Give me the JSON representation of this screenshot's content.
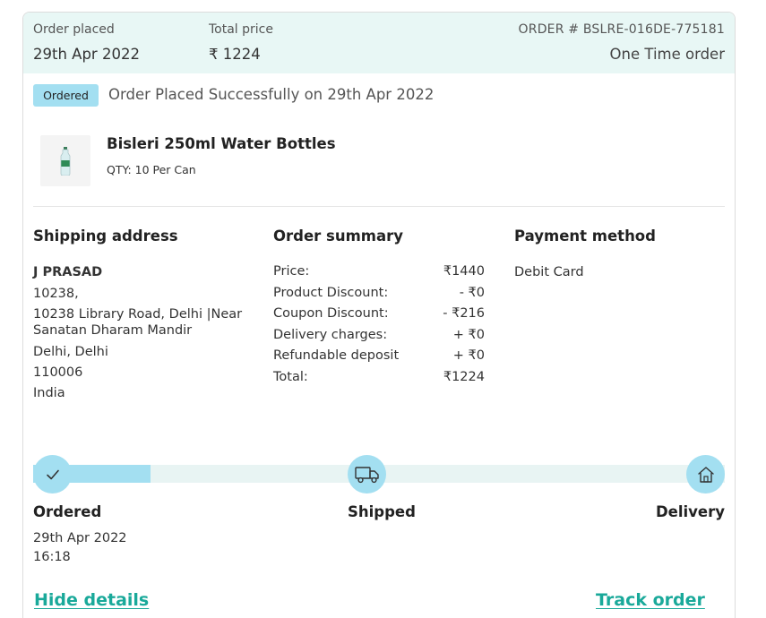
{
  "header": {
    "placed_label": "Order placed",
    "placed_date": "29th Apr 2022",
    "total_label": "Total price",
    "total_value": "₹ 1224",
    "order_number": "ORDER # BSLRE-016DE-775181",
    "order_type": "One Time order"
  },
  "status": {
    "badge": "Ordered",
    "message": "Order Placed Successfully on 29th Apr 2022"
  },
  "product": {
    "icon": "water-bottle-icon",
    "name": "Bisleri 250ml Water Bottles",
    "qty": "QTY: 10 Per Can"
  },
  "shipping": {
    "title": "Shipping address",
    "name": "J PRASAD",
    "line1": "10238,",
    "line2": "10238 Library Road, Delhi |Near Sanatan Dharam Mandir",
    "line3": "Delhi, Delhi",
    "pincode": "110006",
    "country": "India"
  },
  "summary": {
    "title": "Order summary",
    "rows": [
      {
        "label": "Price:",
        "value": "₹1440"
      },
      {
        "label": "Product Discount:",
        "value": "- ₹0"
      },
      {
        "label": "Coupon Discount:",
        "value": "- ₹216"
      },
      {
        "label": "Delivery charges:",
        "value": "+ ₹0"
      },
      {
        "label": "Refundable deposit",
        "value": "+ ₹0"
      },
      {
        "label": "Total:",
        "value": "₹1224"
      }
    ]
  },
  "payment": {
    "title": "Payment method",
    "method": "Debit Card"
  },
  "tracking": {
    "progress_fraction": 0.17,
    "steps": [
      {
        "label": "Ordered",
        "icon": "check-icon"
      },
      {
        "label": "Shipped",
        "icon": "truck-icon"
      },
      {
        "label": "Delivery",
        "icon": "home-icon"
      }
    ],
    "ordered_date": "29th Apr 2022",
    "ordered_time": "16:18"
  },
  "actions": {
    "hide_details": "Hide details",
    "track_order": "Track order"
  },
  "colors": {
    "header_bg": "#e8f7f5",
    "accent": "#a3dff1",
    "link": "#1aa99a"
  }
}
